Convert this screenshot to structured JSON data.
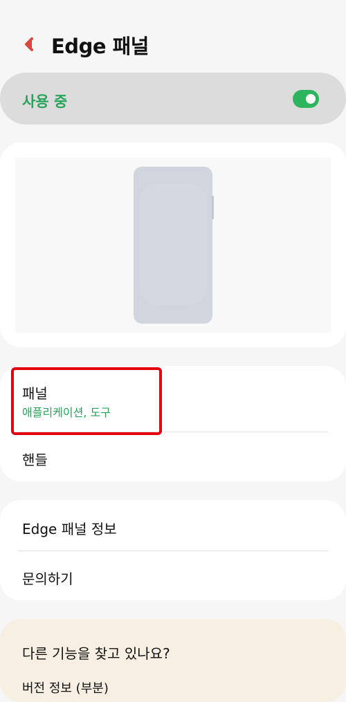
{
  "header": {
    "title": "Edge 패널",
    "back_icon": "back-arrow-icon"
  },
  "master_switch": {
    "label": "사용 중",
    "on": true,
    "accent": "#2db45f"
  },
  "preview": {
    "image": "phone-preview"
  },
  "settings": [
    {
      "title": "패널",
      "subtitle": "애플리케이션, 도구"
    },
    {
      "title": "핸들"
    }
  ],
  "about": [
    {
      "title": "Edge 패널 정보"
    },
    {
      "title": "문의하기"
    }
  ],
  "suggestions": {
    "title": "다른 기능을 찾고 있나요?",
    "next_item": "버전 정보 (부분)"
  }
}
